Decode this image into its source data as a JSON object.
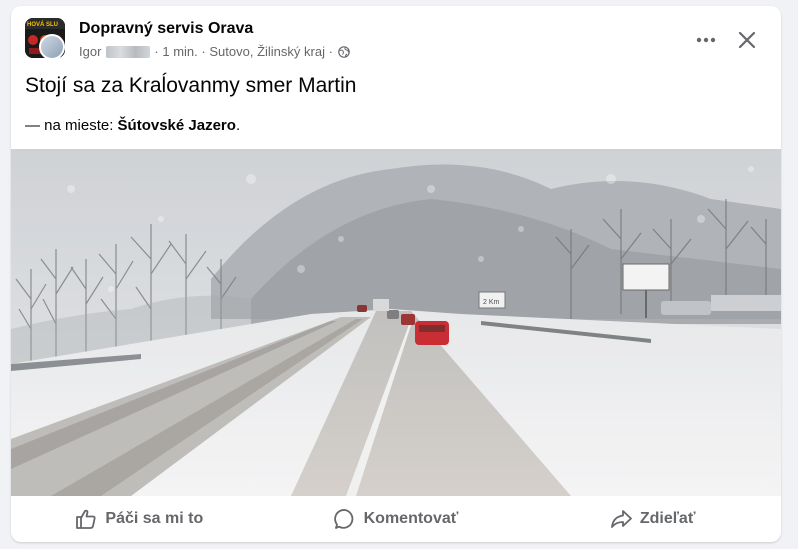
{
  "post": {
    "page_name": "Dopravný servis Orava",
    "author": "Igor",
    "time": "1 min.",
    "place": "Sutovo, Žilinský kraj",
    "separator": "·",
    "text": "Stojí sa za Kraĺovanmy smer Martin",
    "location_prefix": "— na mieste: ",
    "location_name": "Šútovské Jazero",
    "location_suffix": "."
  },
  "avatar": {
    "label": "HOVÁ SLU"
  },
  "road_sign": {
    "text": "2 Km"
  },
  "actions": {
    "like": "Páči sa mi to",
    "comment": "Komentovať",
    "share": "Zdieľať"
  },
  "icons": {
    "more": "more-horizontal-icon",
    "close": "close-icon",
    "audience": "globe-icon",
    "like": "thumbs-up-icon",
    "comment": "comment-bubble-icon",
    "share": "share-arrow-icon"
  },
  "colors": {
    "text_primary": "#050505",
    "text_secondary": "#65676b",
    "background": "#f0f2f5",
    "card": "#ffffff"
  }
}
